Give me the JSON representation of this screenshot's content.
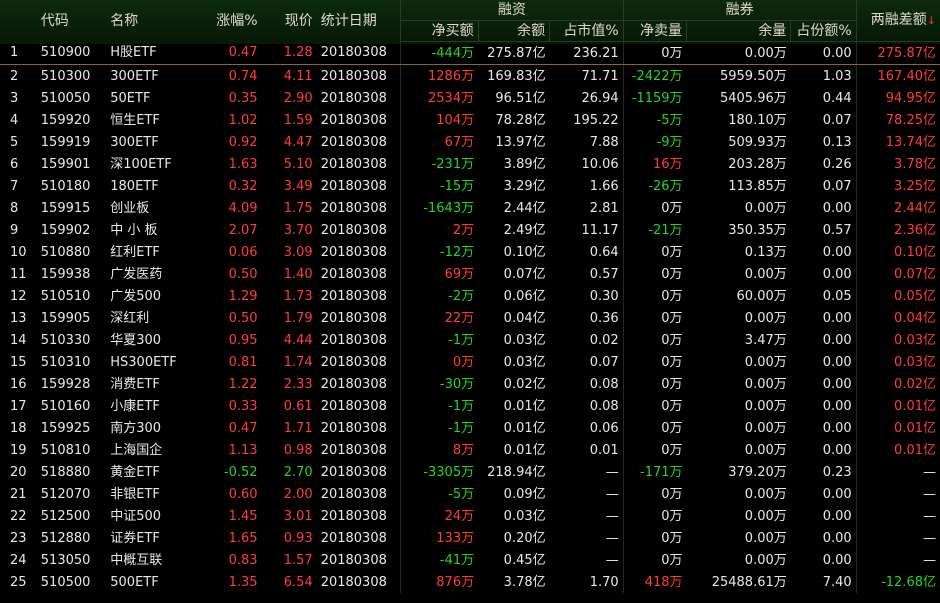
{
  "header": {
    "code": "代码",
    "name": "名称",
    "change_pct": "涨幅%",
    "price": "现价",
    "stat_date": "统计日期",
    "margin_group": "融资",
    "short_group": "融券",
    "spread": "两融差额",
    "sort_indicator": "↓",
    "net_buy": "净买额",
    "margin_balance": "余额",
    "market_cap_pct": "占市值%",
    "net_sell": "净卖量",
    "short_balance": "余量",
    "share_pct": "占份额%"
  },
  "colors": {
    "up": "#ff3c3c",
    "down": "#22d622",
    "neutral": "#e8e8e8"
  },
  "rows": [
    {
      "idx": "1",
      "code": "510900",
      "name": "H股ETF",
      "chg": "0.47",
      "chg_c": "red",
      "price": "1.28",
      "price_c": "red",
      "date": "20180308",
      "netbuy": "-444万",
      "netbuy_c": "green",
      "bal": "275.87亿",
      "mcap": "236.21",
      "netsell": "0万",
      "netsell_c": "white",
      "short": "0.00万",
      "share": "0.00",
      "spread": "275.87亿",
      "spread_c": "red"
    },
    {
      "idx": "2",
      "code": "510300",
      "name": "300ETF",
      "chg": "0.74",
      "chg_c": "red",
      "price": "4.11",
      "price_c": "red",
      "date": "20180308",
      "netbuy": "1286万",
      "netbuy_c": "red",
      "bal": "169.83亿",
      "mcap": "71.71",
      "netsell": "-2422万",
      "netsell_c": "green",
      "short": "5959.50万",
      "share": "1.03",
      "spread": "167.40亿",
      "spread_c": "red"
    },
    {
      "idx": "3",
      "code": "510050",
      "name": "50ETF",
      "chg": "0.35",
      "chg_c": "red",
      "price": "2.90",
      "price_c": "red",
      "date": "20180308",
      "netbuy": "2534万",
      "netbuy_c": "red",
      "bal": "96.51亿",
      "mcap": "26.94",
      "netsell": "-1159万",
      "netsell_c": "green",
      "short": "5405.96万",
      "share": "0.44",
      "spread": "94.95亿",
      "spread_c": "red"
    },
    {
      "idx": "4",
      "code": "159920",
      "name": "恒生ETF",
      "chg": "1.02",
      "chg_c": "red",
      "price": "1.59",
      "price_c": "red",
      "date": "20180308",
      "netbuy": "104万",
      "netbuy_c": "red",
      "bal": "78.28亿",
      "mcap": "195.22",
      "netsell": "-5万",
      "netsell_c": "green",
      "short": "180.10万",
      "share": "0.07",
      "spread": "78.25亿",
      "spread_c": "red"
    },
    {
      "idx": "5",
      "code": "159919",
      "name": "300ETF",
      "chg": "0.92",
      "chg_c": "red",
      "price": "4.47",
      "price_c": "red",
      "date": "20180308",
      "netbuy": "67万",
      "netbuy_c": "red",
      "bal": "13.97亿",
      "mcap": "7.88",
      "netsell": "-9万",
      "netsell_c": "green",
      "short": "509.93万",
      "share": "0.13",
      "spread": "13.74亿",
      "spread_c": "red"
    },
    {
      "idx": "6",
      "code": "159901",
      "name": "深100ETF",
      "chg": "1.63",
      "chg_c": "red",
      "price": "5.10",
      "price_c": "red",
      "date": "20180308",
      "netbuy": "-231万",
      "netbuy_c": "green",
      "bal": "3.89亿",
      "mcap": "10.06",
      "netsell": "16万",
      "netsell_c": "red",
      "short": "203.28万",
      "share": "0.26",
      "spread": "3.78亿",
      "spread_c": "red"
    },
    {
      "idx": "7",
      "code": "510180",
      "name": "180ETF",
      "chg": "0.32",
      "chg_c": "red",
      "price": "3.49",
      "price_c": "red",
      "date": "20180308",
      "netbuy": "-15万",
      "netbuy_c": "green",
      "bal": "3.29亿",
      "mcap": "1.66",
      "netsell": "-26万",
      "netsell_c": "green",
      "short": "113.85万",
      "share": "0.07",
      "spread": "3.25亿",
      "spread_c": "red"
    },
    {
      "idx": "8",
      "code": "159915",
      "name": "创业板",
      "chg": "4.09",
      "chg_c": "red",
      "price": "1.75",
      "price_c": "red",
      "date": "20180308",
      "netbuy": "-1643万",
      "netbuy_c": "green",
      "bal": "2.44亿",
      "mcap": "2.81",
      "netsell": "0万",
      "netsell_c": "white",
      "short": "0.00万",
      "share": "0.00",
      "spread": "2.44亿",
      "spread_c": "red"
    },
    {
      "idx": "9",
      "code": "159902",
      "name": "中 小 板",
      "chg": "2.07",
      "chg_c": "red",
      "price": "3.70",
      "price_c": "red",
      "date": "20180308",
      "netbuy": "2万",
      "netbuy_c": "red",
      "bal": "2.49亿",
      "mcap": "11.17",
      "netsell": "-21万",
      "netsell_c": "green",
      "short": "350.35万",
      "share": "0.57",
      "spread": "2.36亿",
      "spread_c": "red"
    },
    {
      "idx": "10",
      "code": "510880",
      "name": "红利ETF",
      "chg": "0.06",
      "chg_c": "red",
      "price": "3.09",
      "price_c": "red",
      "date": "20180308",
      "netbuy": "-12万",
      "netbuy_c": "green",
      "bal": "0.10亿",
      "mcap": "0.64",
      "netsell": "0万",
      "netsell_c": "white",
      "short": "0.13万",
      "share": "0.00",
      "spread": "0.10亿",
      "spread_c": "red"
    },
    {
      "idx": "11",
      "code": "159938",
      "name": "广发医药",
      "chg": "0.50",
      "chg_c": "red",
      "price": "1.40",
      "price_c": "red",
      "date": "20180308",
      "netbuy": "69万",
      "netbuy_c": "red",
      "bal": "0.07亿",
      "mcap": "0.57",
      "netsell": "0万",
      "netsell_c": "white",
      "short": "0.00万",
      "share": "0.00",
      "spread": "0.07亿",
      "spread_c": "red"
    },
    {
      "idx": "12",
      "code": "510510",
      "name": "广发500",
      "chg": "1.29",
      "chg_c": "red",
      "price": "1.73",
      "price_c": "red",
      "date": "20180308",
      "netbuy": "-2万",
      "netbuy_c": "green",
      "bal": "0.06亿",
      "mcap": "0.30",
      "netsell": "0万",
      "netsell_c": "white",
      "short": "60.00万",
      "share": "0.05",
      "spread": "0.05亿",
      "spread_c": "red"
    },
    {
      "idx": "13",
      "code": "159905",
      "name": "深红利",
      "chg": "0.50",
      "chg_c": "red",
      "price": "1.79",
      "price_c": "red",
      "date": "20180308",
      "netbuy": "22万",
      "netbuy_c": "red",
      "bal": "0.04亿",
      "mcap": "0.36",
      "netsell": "0万",
      "netsell_c": "white",
      "short": "0.00万",
      "share": "0.00",
      "spread": "0.04亿",
      "spread_c": "red"
    },
    {
      "idx": "14",
      "code": "510330",
      "name": "华夏300",
      "chg": "0.95",
      "chg_c": "red",
      "price": "4.44",
      "price_c": "red",
      "date": "20180308",
      "netbuy": "-1万",
      "netbuy_c": "green",
      "bal": "0.03亿",
      "mcap": "0.02",
      "netsell": "0万",
      "netsell_c": "white",
      "short": "3.47万",
      "share": "0.00",
      "spread": "0.03亿",
      "spread_c": "red"
    },
    {
      "idx": "15",
      "code": "510310",
      "name": "HS300ETF",
      "chg": "0.81",
      "chg_c": "red",
      "price": "1.74",
      "price_c": "red",
      "date": "20180308",
      "netbuy": "0万",
      "netbuy_c": "red",
      "bal": "0.03亿",
      "mcap": "0.07",
      "netsell": "0万",
      "netsell_c": "white",
      "short": "0.00万",
      "share": "0.00",
      "spread": "0.03亿",
      "spread_c": "red"
    },
    {
      "idx": "16",
      "code": "159928",
      "name": "消费ETF",
      "chg": "1.22",
      "chg_c": "red",
      "price": "2.33",
      "price_c": "red",
      "date": "20180308",
      "netbuy": "-30万",
      "netbuy_c": "green",
      "bal": "0.02亿",
      "mcap": "0.08",
      "netsell": "0万",
      "netsell_c": "white",
      "short": "0.00万",
      "share": "0.00",
      "spread": "0.02亿",
      "spread_c": "red"
    },
    {
      "idx": "17",
      "code": "510160",
      "name": "小康ETF",
      "chg": "0.33",
      "chg_c": "red",
      "price": "0.61",
      "price_c": "red",
      "date": "20180308",
      "netbuy": "-1万",
      "netbuy_c": "green",
      "bal": "0.01亿",
      "mcap": "0.08",
      "netsell": "0万",
      "netsell_c": "white",
      "short": "0.00万",
      "share": "0.00",
      "spread": "0.01亿",
      "spread_c": "red"
    },
    {
      "idx": "18",
      "code": "159925",
      "name": "南方300",
      "chg": "0.47",
      "chg_c": "red",
      "price": "1.71",
      "price_c": "red",
      "date": "20180308",
      "netbuy": "-1万",
      "netbuy_c": "green",
      "bal": "0.01亿",
      "mcap": "0.06",
      "netsell": "0万",
      "netsell_c": "white",
      "short": "0.00万",
      "share": "0.00",
      "spread": "0.01亿",
      "spread_c": "red"
    },
    {
      "idx": "19",
      "code": "510810",
      "name": "上海国企",
      "chg": "1.13",
      "chg_c": "red",
      "price": "0.98",
      "price_c": "red",
      "date": "20180308",
      "netbuy": "8万",
      "netbuy_c": "red",
      "bal": "0.01亿",
      "mcap": "0.01",
      "netsell": "0万",
      "netsell_c": "white",
      "short": "0.00万",
      "share": "0.00",
      "spread": "0.01亿",
      "spread_c": "red"
    },
    {
      "idx": "20",
      "code": "518880",
      "name": "黄金ETF",
      "chg": "-0.52",
      "chg_c": "green",
      "price": "2.70",
      "price_c": "green",
      "date": "20180308",
      "netbuy": "-3305万",
      "netbuy_c": "green",
      "bal": "218.94亿",
      "mcap": "—",
      "netsell": "-171万",
      "netsell_c": "green",
      "short": "379.20万",
      "share": "0.23",
      "spread": "—",
      "spread_c": "white"
    },
    {
      "idx": "21",
      "code": "512070",
      "name": "非银ETF",
      "chg": "0.60",
      "chg_c": "red",
      "price": "2.00",
      "price_c": "red",
      "date": "20180308",
      "netbuy": "-5万",
      "netbuy_c": "green",
      "bal": "0.09亿",
      "mcap": "—",
      "netsell": "0万",
      "netsell_c": "white",
      "short": "0.00万",
      "share": "0.00",
      "spread": "—",
      "spread_c": "white"
    },
    {
      "idx": "22",
      "code": "512500",
      "name": "中证500",
      "chg": "1.45",
      "chg_c": "red",
      "price": "3.01",
      "price_c": "red",
      "date": "20180308",
      "netbuy": "24万",
      "netbuy_c": "red",
      "bal": "0.03亿",
      "mcap": "—",
      "netsell": "0万",
      "netsell_c": "white",
      "short": "0.00万",
      "share": "0.00",
      "spread": "—",
      "spread_c": "white"
    },
    {
      "idx": "23",
      "code": "512880",
      "name": "证券ETF",
      "chg": "1.65",
      "chg_c": "red",
      "price": "0.93",
      "price_c": "red",
      "date": "20180308",
      "netbuy": "133万",
      "netbuy_c": "red",
      "bal": "0.20亿",
      "mcap": "—",
      "netsell": "0万",
      "netsell_c": "white",
      "short": "0.00万",
      "share": "0.00",
      "spread": "—",
      "spread_c": "white"
    },
    {
      "idx": "24",
      "code": "513050",
      "name": "中概互联",
      "chg": "0.83",
      "chg_c": "red",
      "price": "1.57",
      "price_c": "red",
      "date": "20180308",
      "netbuy": "-41万",
      "netbuy_c": "green",
      "bal": "0.45亿",
      "mcap": "—",
      "netsell": "0万",
      "netsell_c": "white",
      "short": "0.00万",
      "share": "0.00",
      "spread": "—",
      "spread_c": "white"
    },
    {
      "idx": "25",
      "code": "510500",
      "name": "500ETF",
      "chg": "1.35",
      "chg_c": "red",
      "price": "6.54",
      "price_c": "red",
      "date": "20180308",
      "netbuy": "876万",
      "netbuy_c": "red",
      "bal": "3.78亿",
      "mcap": "1.70",
      "netsell": "418万",
      "netsell_c": "red",
      "short": "25488.61万",
      "share": "7.40",
      "spread": "-12.68亿",
      "spread_c": "green"
    }
  ]
}
